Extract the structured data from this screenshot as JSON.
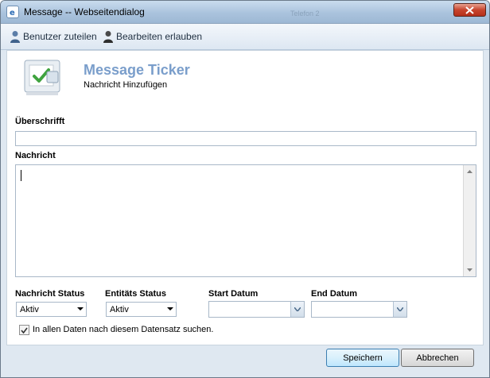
{
  "window": {
    "title": "Message -- Webseitendialog",
    "ghost_tab": "Telefon 2"
  },
  "toolbar": {
    "assign_label": "Benutzer zuteilen",
    "edit_label": "Bearbeiten erlauben"
  },
  "header": {
    "title": "Message Ticker",
    "subtitle": "Nachricht Hinzufügen"
  },
  "form": {
    "headline_label": "Überschrifft",
    "headline_value": "",
    "message_label": "Nachricht",
    "message_value": "",
    "message_status_label": "Nachricht Status",
    "message_status_value": "Aktiv",
    "entity_status_label": "Entitäts Status",
    "entity_status_value": "Aktiv",
    "start_date_label": "Start Datum",
    "start_date_value": "",
    "end_date_label": "End Datum",
    "end_date_value": "",
    "search_checkbox_label": "In allen Daten nach diesem Datensatz suchen.",
    "search_checkbox_checked": true
  },
  "buttons": {
    "save_label": "Speichern",
    "cancel_label": "Abbrechen"
  },
  "colors": {
    "accent": "#7a9ecb",
    "window_bg": "#dfe8f1",
    "close_button": "#c7442d"
  }
}
